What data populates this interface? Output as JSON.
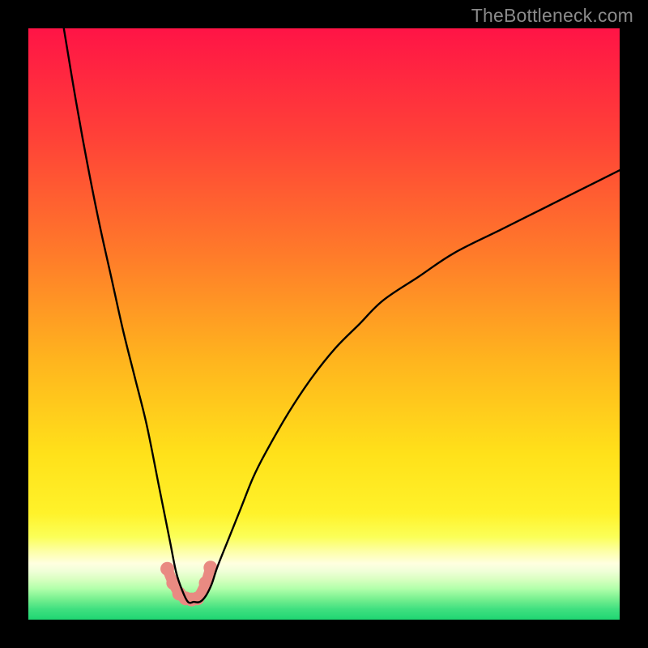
{
  "watermark": "TheBottleneck.com",
  "chart_data": {
    "type": "line",
    "title": "",
    "xlabel": "",
    "ylabel": "",
    "xlim": [
      0,
      100
    ],
    "ylim": [
      0,
      100
    ],
    "grid": false,
    "legend": false,
    "note": "Bottleneck-style V-curve, minimum near x≈27, y≈3; left branch rises to y≈100 at x≈6; right branch rises to y≈76 at x≈100.",
    "series": [
      {
        "name": "bottleneck-curve",
        "color": "#000000",
        "x": [
          6,
          8,
          10,
          12,
          14,
          16,
          18,
          20,
          22,
          23,
          24,
          25,
          26,
          27,
          28,
          29,
          30,
          31,
          32,
          34,
          36,
          38,
          40,
          44,
          48,
          52,
          56,
          60,
          66,
          72,
          80,
          88,
          96,
          100
        ],
        "y": [
          100,
          88,
          77,
          67,
          58,
          49,
          41,
          33,
          23,
          18,
          13,
          8,
          5,
          3,
          3,
          3,
          4,
          6,
          9,
          14,
          19,
          24,
          28,
          35,
          41,
          46,
          50,
          54,
          58,
          62,
          66,
          70,
          74,
          76
        ]
      }
    ],
    "valley_markers": {
      "note": "Salmon dots and short arc near the curve minimum",
      "color": "#e98a82",
      "points_x": [
        23.5,
        24.5,
        25.5,
        26.6,
        27.6,
        28.6,
        30.0,
        30.8
      ],
      "points_y": [
        8.6,
        6.2,
        4.4,
        3.6,
        3.4,
        3.6,
        6.2,
        8.8
      ]
    },
    "gradient_stops": [
      {
        "offset": 0.0,
        "color": "#ff1446"
      },
      {
        "offset": 0.18,
        "color": "#ff4038"
      },
      {
        "offset": 0.38,
        "color": "#ff7a2a"
      },
      {
        "offset": 0.56,
        "color": "#ffb41e"
      },
      {
        "offset": 0.72,
        "color": "#ffe11a"
      },
      {
        "offset": 0.82,
        "color": "#fff22a"
      },
      {
        "offset": 0.86,
        "color": "#fbff58"
      },
      {
        "offset": 0.885,
        "color": "#fdffa8"
      },
      {
        "offset": 0.905,
        "color": "#ffffe0"
      },
      {
        "offset": 0.918,
        "color": "#f0ffd8"
      },
      {
        "offset": 0.932,
        "color": "#d8ffc0"
      },
      {
        "offset": 0.948,
        "color": "#b0ffaa"
      },
      {
        "offset": 0.965,
        "color": "#78f090"
      },
      {
        "offset": 0.982,
        "color": "#40e080"
      },
      {
        "offset": 1.0,
        "color": "#1fd672"
      }
    ]
  }
}
